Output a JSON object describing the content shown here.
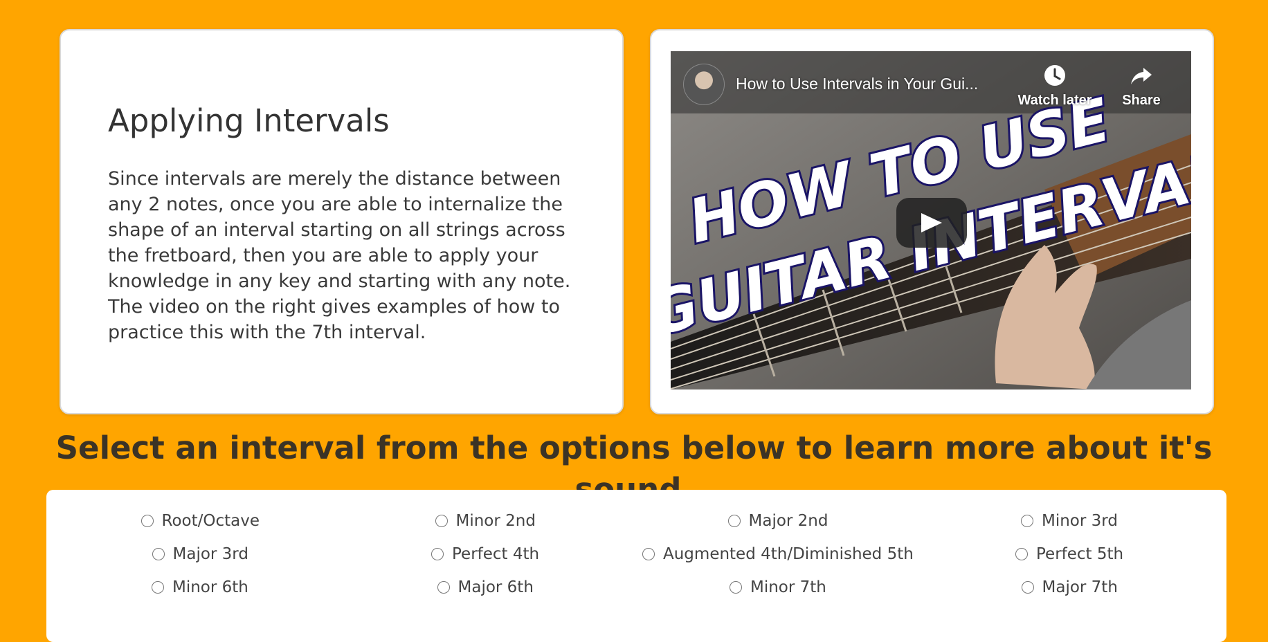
{
  "info": {
    "title": "Applying Intervals",
    "text": "Since intervals are merely the distance between any 2 notes, once you are able to internalize the shape of an interval starting on all strings across the fretboard, then you are able to apply your knowledge in any key and starting with any note. The video on the right gives examples of how to practice this with the 7th interval."
  },
  "video": {
    "title": "How to Use Intervals in Your Gui...",
    "watch_later_label": "Watch later",
    "share_label": "Share",
    "thumbnail_text_line1": "HOW TO USE",
    "thumbnail_text_line2": "GUITAR INTERVALS"
  },
  "prompt": "Select an interval from the options below to learn more about it's sound.",
  "intervals": [
    "Root/Octave",
    "Minor 2nd",
    "Major 2nd",
    "Minor 3rd",
    "Major 3rd",
    "Perfect 4th",
    "Augmented 4th/Diminished 5th",
    "Perfect 5th",
    "Minor 6th",
    "Major 6th",
    "Minor 7th",
    "Major 7th"
  ],
  "colors": {
    "page_background": "#FFA500",
    "card_background": "#ffffff",
    "heading_text": "#3b3326"
  }
}
